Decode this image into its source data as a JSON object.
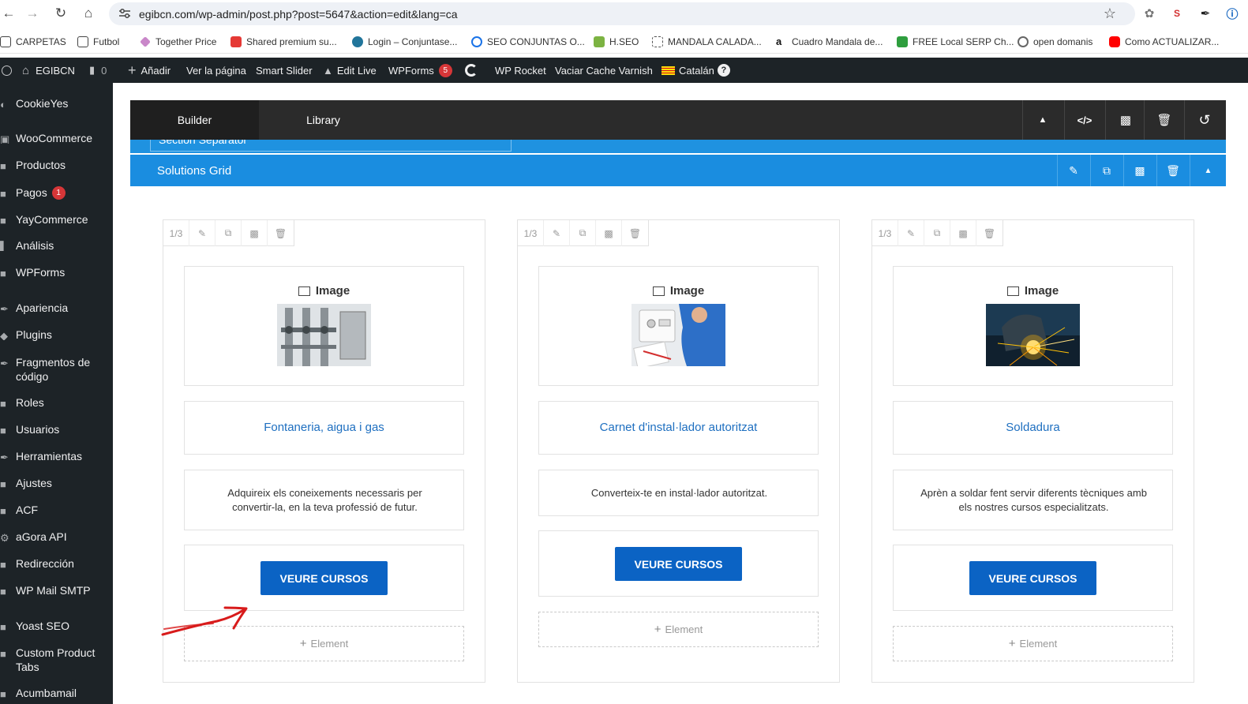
{
  "browser": {
    "url": "egibcn.com/wp-admin/post.php?post=5647&action=edit&lang=ca",
    "bookmarks": [
      {
        "label": "CARPETAS",
        "color": "#333333"
      },
      {
        "label": "Futbol",
        "color": "#333333"
      },
      {
        "label": "Together Price",
        "color": "#c987c9"
      },
      {
        "label": "Shared premium su...",
        "color": "#e53935"
      },
      {
        "label": "Login – Conjuntase...",
        "color": "#21759b"
      },
      {
        "label": "SEO CONJUNTAS O...",
        "color": "#1a73e8"
      },
      {
        "label": "H.SEO",
        "color": "#7cb342"
      },
      {
        "label": "MANDALA CALADA...",
        "color": "#555555"
      },
      {
        "label": "Cuadro Mandala de...",
        "color": "#111111"
      },
      {
        "label": "FREE Local SERP Ch...",
        "color": "#2e9e3e"
      },
      {
        "label": "open domanis",
        "color": "#666666"
      },
      {
        "label": "Como ACTUALIZAR...",
        "color": "#ff0000"
      }
    ]
  },
  "adminbar": {
    "site_name": "EGIBCN",
    "comments_count": "0",
    "add_new": "Añadir",
    "view_page": "Ver la página",
    "smart_slider": "Smart Slider",
    "edit_live": "Edit Live",
    "wpforms": "WPForms",
    "wpforms_badge": "5",
    "wp_rocket": "WP Rocket",
    "varnish": "Vaciar Cache Varnish",
    "language": "Catalán",
    "help": "?"
  },
  "sidebar": {
    "items": [
      {
        "label": "CookieYes"
      },
      {
        "label": "WooCommerce"
      },
      {
        "label": "Productos"
      },
      {
        "label": "Pagos",
        "badge": "1"
      },
      {
        "label": "YayCommerce"
      },
      {
        "label": "Análisis"
      },
      {
        "label": "WPForms"
      },
      {
        "label": "Apariencia"
      },
      {
        "label": "Plugins"
      },
      {
        "label": "Fragmentos de código"
      },
      {
        "label": "Roles"
      },
      {
        "label": "Usuarios"
      },
      {
        "label": "Herramientas"
      },
      {
        "label": "Ajustes"
      },
      {
        "label": "ACF"
      },
      {
        "label": "aGora API"
      },
      {
        "label": "Redirección"
      },
      {
        "label": "WP Mail SMTP"
      },
      {
        "label": "Yoast SEO"
      },
      {
        "label": "Custom Product Tabs"
      },
      {
        "label": "Acumbamail"
      }
    ]
  },
  "builder": {
    "tabs": {
      "builder": "Builder",
      "library": "Library"
    },
    "section_separator_input": "Section Separator",
    "section_title": "Solutions Grid",
    "columns": [
      {
        "size": "1/3",
        "image_label": "Image",
        "heading": "Fontaneria, aigua i gas",
        "text": "Adquireix els coneixements necessaris per convertir-la, en la teva professió de futur.",
        "button": "VEURE CURSOS",
        "add_element": "Element"
      },
      {
        "size": "1/3",
        "image_label": "Image",
        "heading": "Carnet d'instal·lador autoritzat",
        "text": "Converteix-te en instal·lador autoritzat.",
        "button": "VEURE CURSOS",
        "add_element": "Element"
      },
      {
        "size": "1/3",
        "image_label": "Image",
        "heading": "Soldadura",
        "text": "Aprèn a soldar fent servir diferents tècniques amb els nostres cursos especialitzats.",
        "button": "VEURE CURSOS",
        "add_element": "Element"
      }
    ]
  },
  "colors": {
    "admin_bg": "#1d2327",
    "builder_header": "#2b2b2b",
    "section_blue": "#1a8de0",
    "button_blue": "#0b63c4",
    "heading_blue": "#1e6fc0",
    "annotation_red": "#d81b1b"
  }
}
